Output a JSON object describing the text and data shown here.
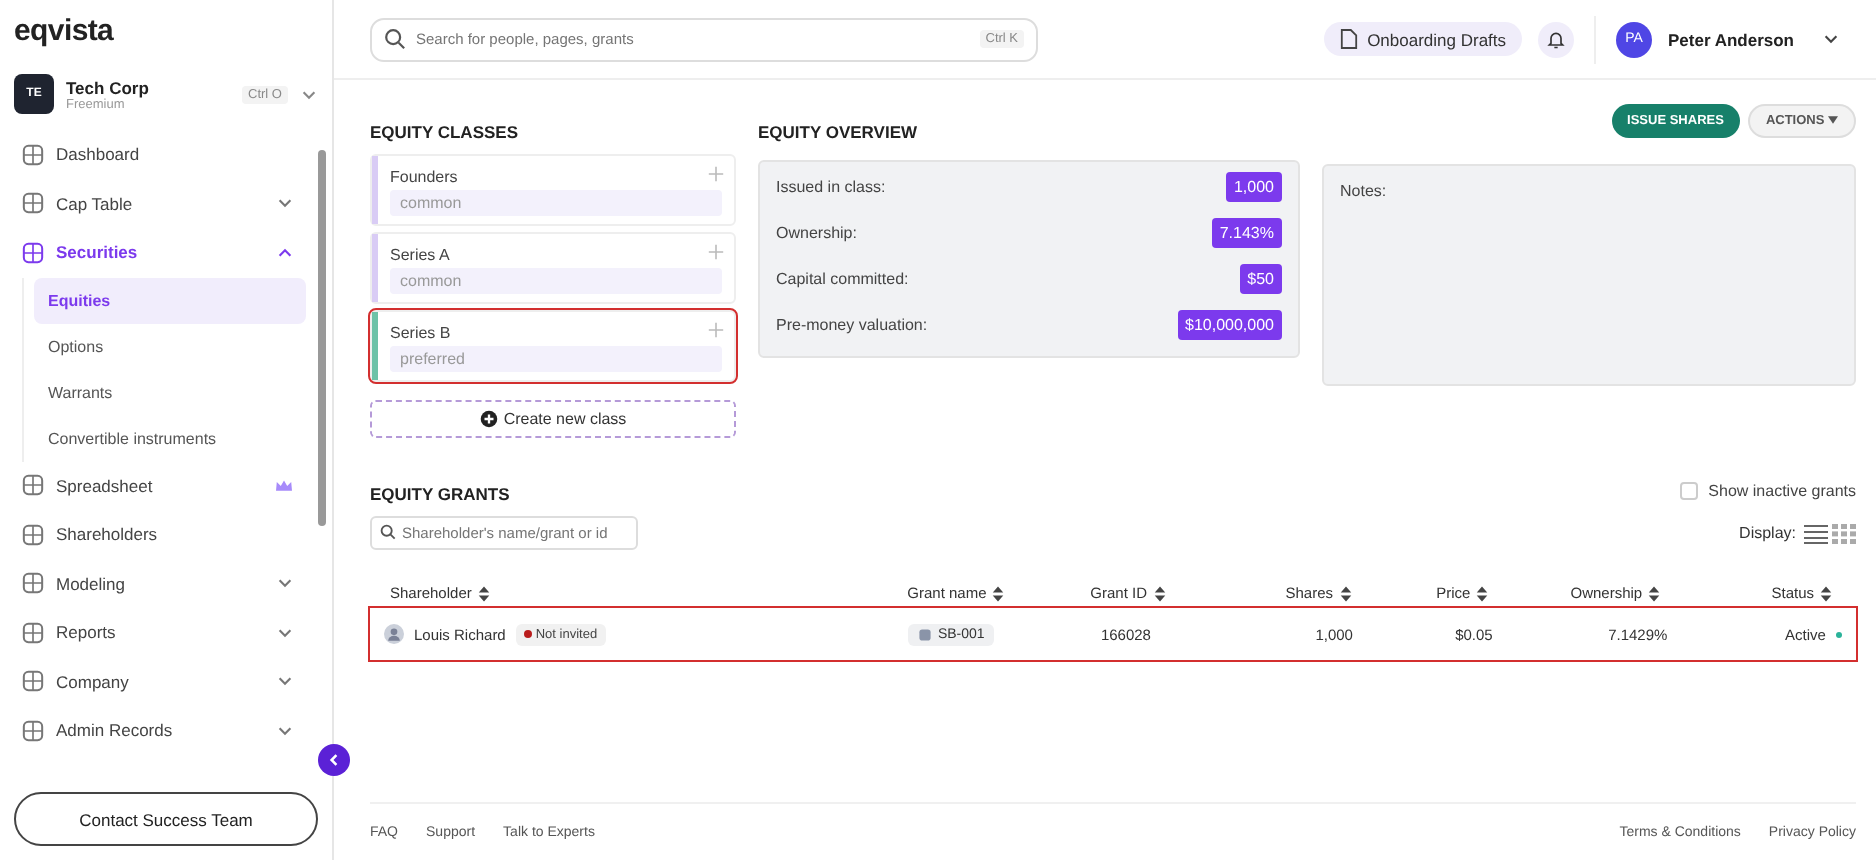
{
  "sidebar": {
    "logo": "eqvista",
    "company": {
      "initials": "TE",
      "name": "Tech Corp",
      "plan": "Freemium",
      "shortcut": "Ctrl O"
    },
    "items": [
      {
        "label": "Dashboard",
        "selected": false
      },
      {
        "label": "Cap Table",
        "selected": false,
        "expanded": false
      },
      {
        "label": "Securities",
        "selected": true,
        "expanded": true,
        "children": [
          {
            "label": "Equities",
            "selected": true
          },
          {
            "label": "Options",
            "selected": false
          },
          {
            "label": "Warrants",
            "selected": false
          },
          {
            "label": "Convertible instruments",
            "selected": false
          }
        ]
      },
      {
        "label": "Spreadsheet",
        "selected": false,
        "premium": true
      },
      {
        "label": "Shareholders",
        "selected": false
      },
      {
        "label": "Modeling",
        "selected": false,
        "expanded": false
      },
      {
        "label": "Reports",
        "selected": false,
        "expanded": false
      },
      {
        "label": "Company",
        "selected": false,
        "expanded": false
      },
      {
        "label": "Admin Records",
        "selected": false,
        "expanded": false
      }
    ],
    "contact_button": "Contact Success Team"
  },
  "topbar": {
    "search": {
      "placeholder": "Search for people, pages, grants",
      "shortcut": "Ctrl K"
    },
    "drafts_button": "Onboarding Drafts",
    "user": {
      "initials": "PA",
      "name": "Peter Anderson"
    }
  },
  "equity_classes": {
    "title": "EQUITY CLASSES",
    "classes": [
      {
        "name": "Founders",
        "type": "common",
        "highlighted": false,
        "color": "#d9ccf5"
      },
      {
        "name": "Series A",
        "type": "common",
        "highlighted": false,
        "color": "#d9ccf5"
      },
      {
        "name": "Series B",
        "type": "preferred",
        "highlighted": true,
        "color": "#6cc2a8"
      }
    ],
    "create_button": "Create new class"
  },
  "overview": {
    "title": "EQUITY OVERVIEW",
    "rows": [
      {
        "label": "Issued in class:",
        "value": "1,000"
      },
      {
        "label": "Ownership:",
        "value": "7.143%"
      },
      {
        "label": "Capital committed:",
        "value": "$50"
      },
      {
        "label": "Pre-money valuation:",
        "value": "$10,000,000"
      }
    ],
    "notes_label": "Notes:"
  },
  "actions": {
    "issue_button": "ISSUE SHARES",
    "actions_button": "ACTIONS"
  },
  "grants": {
    "title": "EQUITY GRANTS",
    "show_inactive": {
      "label": "Show inactive grants",
      "checked": false
    },
    "search": {
      "placeholder": "Shareholder's name/grant or id"
    },
    "display_label": "Display:",
    "columns": [
      "Shareholder",
      "Grant name",
      "Grant ID",
      "Shares",
      "Price",
      "Ownership",
      "Status"
    ],
    "rows": [
      {
        "shareholder": "Louis Richard",
        "invite": {
          "label": "Not invited",
          "color": "#b91c1c"
        },
        "grant_name": "SB-001",
        "grant_id": "166028",
        "shares": "1,000",
        "price": "$0.05",
        "ownership": "7.1429%",
        "status": {
          "label": "Active",
          "color": "#2bb39a"
        },
        "highlighted": true
      }
    ]
  },
  "footer": {
    "left": [
      "FAQ",
      "Support",
      "Talk to Experts"
    ],
    "right": [
      "Terms & Conditions",
      "Privacy Policy"
    ]
  }
}
